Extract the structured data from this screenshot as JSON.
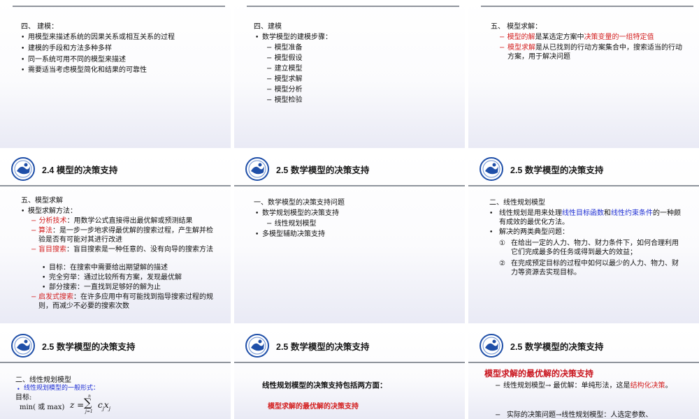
{
  "slides": [
    {
      "header": "",
      "lines": [
        "四、 建模：",
        "用模型来描述系统的因果关系或相互关系的过程",
        "建模的手段和方法多种多样",
        "同一系统可用不同的模型来描述",
        "需要适当考虑模型简化和结果的可靠性"
      ]
    },
    {
      "header": "",
      "lines": [
        "四、建模",
        "数学模型的建模步骤：",
        "模型准备",
        "模型假设",
        "建立模型",
        "模型求解",
        "模型分析",
        "模型检验"
      ]
    },
    {
      "header": "",
      "l1": "五、 模型求解：",
      "l2a": "模型的解",
      "l2b": "是某选定方案中",
      "l2c": "决策变量的一组特定值",
      "l3a": "模型求解",
      "l3b": "是从已找到的行动方案集合中，搜索适当的行动方案，用于解决问题"
    },
    {
      "header": "2.4  模型的决策支持",
      "l1": "五、模型求解",
      "l2": "模型求解方法：",
      "m1a": "分析技术",
      "m1b": "：用数学公式直接得出最优解或预测结果",
      "m2a": "算法",
      "m2b": "：是一步一步地求得最优解的搜索过程，产生解并检验是否有可能对其进行改进",
      "m3a": "盲目搜索",
      "m3b": "：盲目搜索是一种任意的、没有向导的搜索方法",
      "s1": "目标：在搜索中需要给出期望解的描述",
      "s2": "完全穷举：通过比较所有方案，发现最优解",
      "s3": "部分搜索：一直找到足够好的解为止",
      "m4a": "启发式搜索",
      "m4b": "：在许多应用中有可能找到指导搜索过程的规则，而减少不必要的搜索次数"
    },
    {
      "header": "2.5  数学模型的决策支持",
      "lines": [
        "一、数学模型的决策支持问题",
        "数学规划模型的决策支持",
        "线性规划模型",
        "多模型辅助决策支持"
      ]
    },
    {
      "header": "2.5  数学模型的决策支持",
      "l1": "二、线性规划模型",
      "p1a": "线性规划是用来处理",
      "p1b": "线性目标函数",
      "p1c": "和",
      "p1d": "线性约束条件",
      "p1e": "的一种颇有成效的最优化方法。",
      "p2": "解决的两类典型问题：",
      "n1": "①",
      "t1": "在给出一定的人力、物力、财力条件下，如何合理利用它们完成最多的任务或得到最大的效益；",
      "n2": "②",
      "t2": "在完成预定目标的过程中如何以最少的人力、物力、财力等资源去实现目标。"
    },
    {
      "header": "2.5  数学模型的决策支持",
      "l1": "二、线性规划模型",
      "l2": "线性规划模型的一般形式：",
      "l3": "目标:",
      "l4": "min( 或 max)",
      "formula_z": "z = ",
      "formula_sigma": "∑",
      "formula_top": "n",
      "formula_bottom": "j=1",
      "formula_term": "c",
      "formula_sub1": "j",
      "formula_x": "x",
      "formula_sub2": "j"
    },
    {
      "header": "2.5  数学模型的决策支持",
      "l1": "线性规划模型的决策支持包括两方面：",
      "l2": "模型求解的最优解的决策支持"
    },
    {
      "header": "2.5  数学模型的决策支持",
      "l1": "模型求解的最优解的决策支持",
      "l2a": "线性规划模型→  最优解：单纯形法，这是",
      "l2b": "结构化决策",
      "l2c": "。",
      "l3": "实际的决策问题→线性规划模型：人选定参数、"
    }
  ],
  "colors": {
    "red": "#d31f1f",
    "blue": "#1f2fd3",
    "rule": "#8f949c",
    "logo": "#1f4fa8"
  },
  "icons": {
    "logo": "university-logo-icon",
    "bullet": "square-bullet-icon"
  }
}
